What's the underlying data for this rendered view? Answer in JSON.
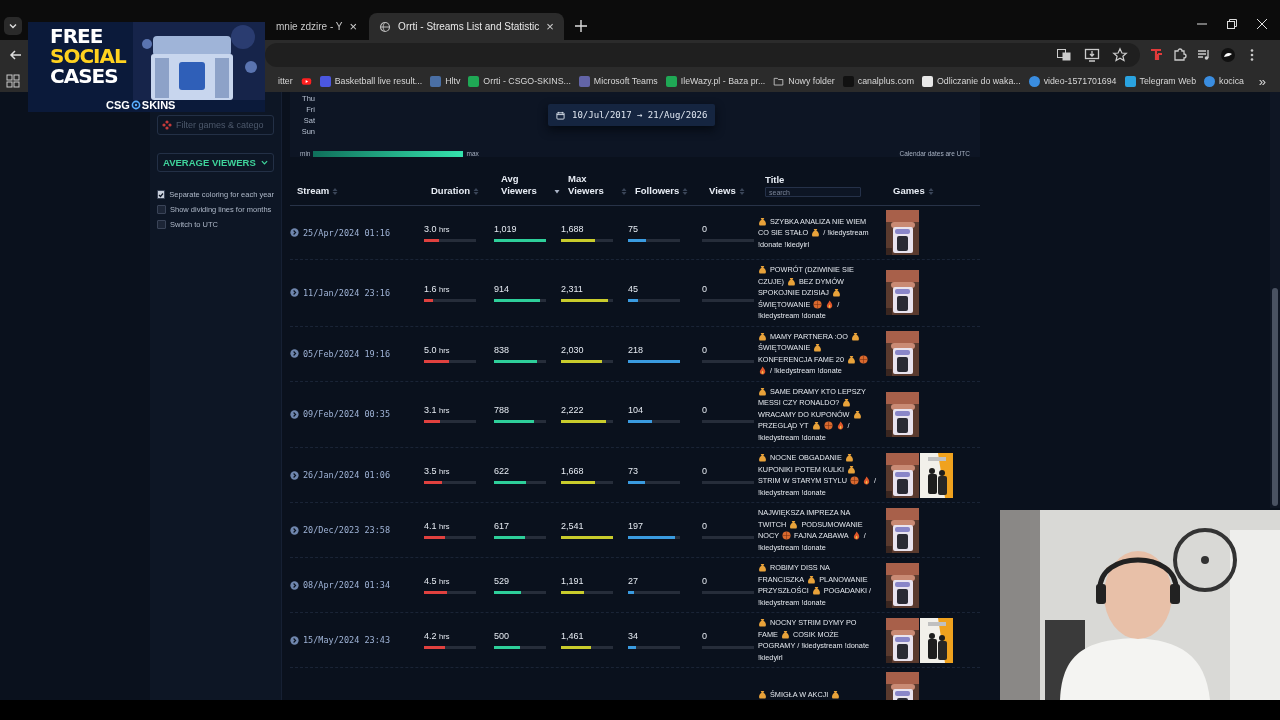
{
  "browser": {
    "tabs": [
      {
        "title": "mnie zdzire - Y",
        "kind": "plain",
        "close": "×",
        "selected": false
      },
      {
        "title": "Orrti - Streams List and Statistic",
        "kind": "web",
        "close": "×",
        "selected": true
      }
    ],
    "bookmarks": [
      {
        "kind": "plain",
        "label": "itter"
      },
      {
        "kind": "video"
      },
      {
        "kind": "app",
        "label": "Basketball live result...",
        "color": "#4b57e0"
      },
      {
        "kind": "app",
        "label": "Hltv",
        "color": "#4a6fa5"
      },
      {
        "kind": "app",
        "label": "Orrti - CSGO-SKINS...",
        "color": "#1fa855"
      },
      {
        "kind": "app",
        "label": "Microsoft Teams",
        "color": "#6264a7"
      },
      {
        "kind": "app",
        "label": "IleWazy.pl - Baza pr...",
        "color": "#1fa855"
      },
      {
        "kind": "folder",
        "label": "Nowy folder"
      },
      {
        "kind": "app",
        "label": "canalplus.com",
        "color": "#111111"
      },
      {
        "kind": "app",
        "label": "Odliczanie do waka...",
        "color": "#e8e8e8"
      },
      {
        "kind": "link",
        "label": "video-1571701694",
        "color": "#3a8de0"
      },
      {
        "kind": "app",
        "label": "Telegram Web",
        "color": "#2aa3e0"
      },
      {
        "kind": "link",
        "label": "kocica",
        "color": "#3a8de0"
      }
    ],
    "overflow": "»"
  },
  "ad": {
    "lines": [
      {
        "text": "FREE",
        "color": "#ffffff"
      },
      {
        "text": "SOCIAL",
        "color": "#ffd21f"
      },
      {
        "text": "CASES",
        "color": "#ffffff"
      }
    ],
    "brand_left": "CSG",
    "brand_right": "SKINS"
  },
  "sidebar": {
    "filter_placeholder": "Filter games & catego",
    "metric": "AVERAGE VIEWERS",
    "options": [
      {
        "label": "Separate coloring for each year",
        "checked": true
      },
      {
        "label": "Show dividing lines for months",
        "checked": false
      },
      {
        "label": "Switch to UTC",
        "checked": false
      }
    ]
  },
  "heatmap": {
    "days": [
      "Thu",
      "Fri",
      "Sat",
      "Sun"
    ],
    "legend_min": "min",
    "legend_max": "max",
    "date_range": "10/Jul/2017 → 21/Aug/2026",
    "note": "Calendar dates are UTC"
  },
  "table": {
    "columns": [
      {
        "label": "Stream",
        "sorted": false
      },
      {
        "label": "Duration",
        "sorted": false
      },
      {
        "label": "Avg Viewers",
        "sorted": true
      },
      {
        "label": "Max Viewers",
        "sorted": false
      },
      {
        "label": "Followers",
        "sorted": false
      },
      {
        "label": "Views",
        "sorted": false
      },
      {
        "label": "Title",
        "search_placeholder": "search"
      },
      {
        "label": "Games",
        "sorted": false
      }
    ],
    "rows": [
      {
        "stream": "25/Apr/2024 01:16",
        "duration": {
          "value": "3.0",
          "unit": "hrs",
          "level": 0.29
        },
        "avg_viewers": {
          "value": "1,019",
          "level": 1.0
        },
        "max_viewers": {
          "value": "1,688",
          "level": 0.66
        },
        "followers": {
          "value": "75",
          "level": 0.34
        },
        "views": {
          "value": "0"
        },
        "title_lines": [
          [
            {
              "kind": "bag"
            },
            {
              "kind": "text",
              "text": "SZYBKA ANALIZA NIE WIEM"
            }
          ],
          [
            {
              "kind": "text",
              "text": "CO SIE STAŁO"
            },
            {
              "kind": "bag"
            },
            {
              "kind": "text",
              "text": "/ !kiedystream"
            }
          ],
          [
            {
              "kind": "text",
              "text": "!donate !kiedyirl"
            }
          ]
        ],
        "games": [
          {
            "kind": "picture"
          }
        ]
      },
      {
        "stream": "11/Jan/2024 23:16",
        "duration": {
          "value": "1.6",
          "unit": "hrs",
          "level": 0.17
        },
        "avg_viewers": {
          "value": "914",
          "level": 0.89
        },
        "max_viewers": {
          "value": "2,311",
          "level": 0.9
        },
        "followers": {
          "value": "45",
          "level": 0.2
        },
        "views": {
          "value": "0"
        },
        "title_lines": [
          [
            {
              "kind": "bag"
            },
            {
              "kind": "text",
              "text": "POWRÓT (DZIWINIE SIE"
            }
          ],
          [
            {
              "kind": "text",
              "text": "CZUJE)"
            },
            {
              "kind": "bag"
            },
            {
              "kind": "text",
              "text": "BEZ DYMÓW"
            }
          ],
          [
            {
              "kind": "text",
              "text": "SPOKOJNIE DZISIAJ"
            },
            {
              "kind": "bag"
            }
          ],
          [
            {
              "kind": "text",
              "text": "ŚWIĘTOWANIE"
            },
            {
              "kind": "ball"
            },
            {
              "kind": "flame"
            },
            {
              "kind": "text",
              "text": "/"
            }
          ],
          [
            {
              "kind": "text",
              "text": "!kiedystream !donate"
            }
          ]
        ],
        "games": [
          {
            "kind": "picture"
          }
        ]
      },
      {
        "stream": "05/Feb/2024 19:16",
        "duration": {
          "value": "5.0",
          "unit": "hrs",
          "level": 0.49
        },
        "avg_viewers": {
          "value": "838",
          "level": 0.82
        },
        "max_viewers": {
          "value": "2,030",
          "level": 0.79
        },
        "followers": {
          "value": "218",
          "level": 1.0
        },
        "views": {
          "value": "0"
        },
        "title_lines": [
          [
            {
              "kind": "bag"
            },
            {
              "kind": "text",
              "text": "MAMY PARTNERA :OO"
            },
            {
              "kind": "bag"
            }
          ],
          [
            {
              "kind": "text",
              "text": "ŚWIĘTOWANIE"
            },
            {
              "kind": "bag"
            }
          ],
          [
            {
              "kind": "text",
              "text": "KONFERENCJA FAME 20"
            },
            {
              "kind": "bag"
            },
            {
              "kind": "ball"
            }
          ],
          [
            {
              "kind": "flame"
            },
            {
              "kind": "text",
              "text": "/ !kiedystream !donate"
            }
          ]
        ],
        "games": [
          {
            "kind": "picture"
          }
        ]
      },
      {
        "stream": "09/Feb/2024 00:35",
        "duration": {
          "value": "3.1",
          "unit": "hrs",
          "level": 0.3
        },
        "avg_viewers": {
          "value": "788",
          "level": 0.77
        },
        "max_viewers": {
          "value": "2,222",
          "level": 0.87
        },
        "followers": {
          "value": "104",
          "level": 0.47
        },
        "views": {
          "value": "0"
        },
        "title_lines": [
          [
            {
              "kind": "bag"
            },
            {
              "kind": "text",
              "text": "SAME DRAMY KTO LEPSZY"
            }
          ],
          [
            {
              "kind": "text",
              "text": "MESSI CZY RONALDO?"
            },
            {
              "kind": "bag"
            }
          ],
          [
            {
              "kind": "text",
              "text": "WRACAMY DO KUPONÓW"
            },
            {
              "kind": "bag"
            }
          ],
          [
            {
              "kind": "text",
              "text": "PRZEGLĄD YT"
            },
            {
              "kind": "bag"
            },
            {
              "kind": "ball"
            },
            {
              "kind": "flame"
            },
            {
              "kind": "text",
              "text": "/"
            }
          ],
          [
            {
              "kind": "text",
              "text": "!kiedystream !donate"
            }
          ]
        ],
        "games": [
          {
            "kind": "picture"
          }
        ]
      },
      {
        "stream": "26/Jan/2024 01:06",
        "duration": {
          "value": "3.5",
          "unit": "hrs",
          "level": 0.34
        },
        "avg_viewers": {
          "value": "622",
          "level": 0.61
        },
        "max_viewers": {
          "value": "1,668",
          "level": 0.65
        },
        "followers": {
          "value": "73",
          "level": 0.32
        },
        "views": {
          "value": "0"
        },
        "title_lines": [
          [
            {
              "kind": "bag"
            },
            {
              "kind": "text",
              "text": "NOCNE OBGADANIE"
            },
            {
              "kind": "bag"
            }
          ],
          [
            {
              "kind": "text",
              "text": "KUPONIKI POTEM KULKI"
            },
            {
              "kind": "bag"
            }
          ],
          [
            {
              "kind": "text",
              "text": "STRIM W STARYM STYLU"
            },
            {
              "kind": "ball"
            },
            {
              "kind": "flame"
            },
            {
              "kind": "text",
              "text": "/"
            }
          ],
          [
            {
              "kind": "text",
              "text": "!kiedystream !donate"
            }
          ]
        ],
        "games": [
          {
            "kind": "picture"
          },
          {
            "kind": "picture"
          }
        ]
      },
      {
        "stream": "20/Dec/2023 23:58",
        "duration": {
          "value": "4.1",
          "unit": "hrs",
          "level": 0.4
        },
        "avg_viewers": {
          "value": "617",
          "level": 0.6
        },
        "max_viewers": {
          "value": "2,541",
          "level": 1.0
        },
        "followers": {
          "value": "197",
          "level": 0.9
        },
        "views": {
          "value": "0"
        },
        "title_lines": [
          [
            {
              "kind": "text",
              "text": "NAJWIĘKSZA IMPREZA NA"
            }
          ],
          [
            {
              "kind": "text",
              "text": "TWITCH"
            },
            {
              "kind": "bag"
            },
            {
              "kind": "text",
              "text": "PODSUMOWANIE"
            }
          ],
          [
            {
              "kind": "text",
              "text": "NOCY"
            },
            {
              "kind": "ball"
            },
            {
              "kind": "text",
              "text": "FAJNA ZABAWA"
            },
            {
              "kind": "flame"
            },
            {
              "kind": "text",
              "text": "/"
            }
          ],
          [
            {
              "kind": "text",
              "text": "!kiedystream !donate"
            }
          ]
        ],
        "games": [
          {
            "kind": "picture"
          }
        ]
      },
      {
        "stream": "08/Apr/2024 01:34",
        "duration": {
          "value": "4.5",
          "unit": "hrs",
          "level": 0.44
        },
        "avg_viewers": {
          "value": "529",
          "level": 0.51
        },
        "max_viewers": {
          "value": "1,191",
          "level": 0.45
        },
        "followers": {
          "value": "27",
          "level": 0.12
        },
        "views": {
          "value": "0"
        },
        "title_lines": [
          [
            {
              "kind": "bag"
            },
            {
              "kind": "text",
              "text": "ROBIMY DISS NA"
            }
          ],
          [
            {
              "kind": "text",
              "text": "FRANCISZKA"
            },
            {
              "kind": "bag"
            },
            {
              "kind": "text",
              "text": "PLANOWANIE"
            }
          ],
          [
            {
              "kind": "text",
              "text": "PRZYSZŁOŚCI"
            },
            {
              "kind": "bag"
            },
            {
              "kind": "text",
              "text": "POGADANKI /"
            }
          ],
          [
            {
              "kind": "text",
              "text": "!kiedystream !donate"
            }
          ]
        ],
        "games": [
          {
            "kind": "picture"
          }
        ]
      },
      {
        "stream": "15/May/2024 23:43",
        "duration": {
          "value": "4.2",
          "unit": "hrs",
          "level": 0.41
        },
        "avg_viewers": {
          "value": "500",
          "level": 0.5
        },
        "max_viewers": {
          "value": "1,461",
          "level": 0.57
        },
        "followers": {
          "value": "34",
          "level": 0.15
        },
        "views": {
          "value": "0"
        },
        "title_lines": [
          [
            {
              "kind": "bag"
            },
            {
              "kind": "text",
              "text": "NOCNY STRIM DYMY PO"
            }
          ],
          [
            {
              "kind": "text",
              "text": "FAME"
            },
            {
              "kind": "bag"
            },
            {
              "kind": "text",
              "text": "COSIK MOŻE"
            }
          ],
          [
            {
              "kind": "text",
              "text": "POGRAMY / !kiedystream !donate"
            }
          ],
          [
            {
              "kind": "text",
              "text": "!kiedyirl"
            }
          ]
        ],
        "games": [
          {
            "kind": "picture"
          },
          {
            "kind": "picture"
          }
        ]
      },
      {
        "title_lines": [
          [
            {
              "kind": "bag"
            },
            {
              "kind": "text",
              "text": "ŚMIGŁA W AKCJI"
            },
            {
              "kind": "bag"
            }
          ]
        ],
        "games": [
          {
            "kind": "picture"
          }
        ]
      }
    ]
  },
  "webcam": {
    "kind": "picture"
  }
}
